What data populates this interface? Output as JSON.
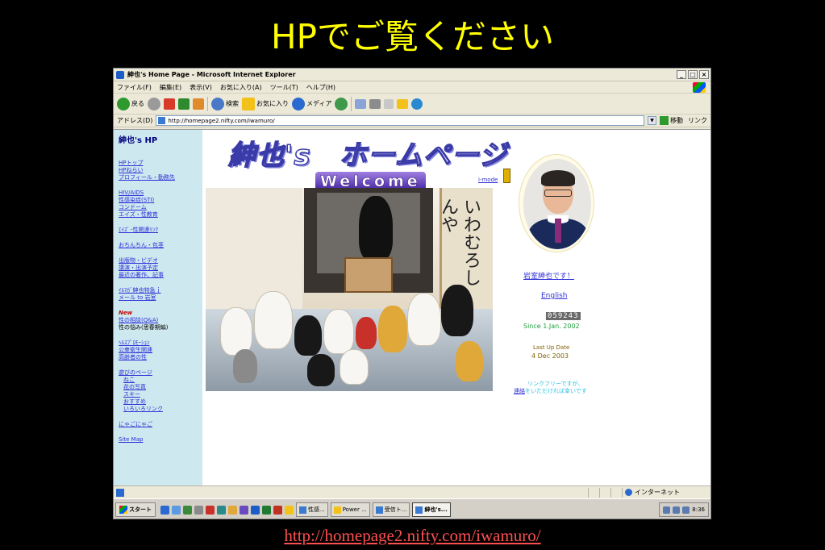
{
  "slide": {
    "title": "HPでご覧ください",
    "url": "http://homepage2.nifty.com/iwamuro/"
  },
  "window": {
    "title": "紳也's Home Page - Microsoft Internet Explorer",
    "controls": [
      "_",
      "□",
      "×"
    ]
  },
  "menu": [
    "ファイル(F)",
    "編集(E)",
    "表示(V)",
    "お気に入り(A)",
    "ツール(T)",
    "ヘルプ(H)"
  ],
  "toolbar": {
    "back": "戻る",
    "search": "検索",
    "favorites": "お気に入り",
    "media": "メディア"
  },
  "address": {
    "label": "アドレス(D)",
    "value": "http://homepage2.nifty.com/iwamuro/",
    "go": "移動",
    "links": "リンク"
  },
  "sidebar": {
    "title": "紳也's HP",
    "group1": [
      "HPトップ",
      "HPねらい",
      "プロフィール・勤務先"
    ],
    "group2": [
      "HIV/AIDS",
      "性感染症(STI)",
      "コンドーム",
      "エイズ・性教育"
    ],
    "group3": [
      "ｴｲｽﾞ･性関連ﾘﾝｸ"
    ],
    "group4": [
      "おちんちん・包茎"
    ],
    "group5": [
      "出版物・ビデオ",
      "講演・出演予定",
      "最近の著作、記事"
    ],
    "group6": [
      "ｲﾙﾏｶﾞ紳也特急ｊ",
      "メール to 岩室"
    ],
    "new_label": "New",
    "group7_link": "性の相談(Q&A)",
    "group7_text": "性の悩み(思春期編)",
    "group8": [
      "ﾍﾙｽﾌﾟﾛﾓｰｼｮﾝ",
      "公衆衛生関連",
      "高齢者の性"
    ],
    "group9": [
      "遊びのページ"
    ],
    "group9_sub": [
      "ねこ",
      "花の写真",
      "スキー",
      "おすすめ",
      "いろいろリンク"
    ],
    "group10": [
      "にゃごにゃご"
    ],
    "group11": [
      "Site Map"
    ]
  },
  "page": {
    "site_title": "紳也's　ホームページ",
    "welcome": "Welcome",
    "imode": "i-mode",
    "scroll_text": "いわむろしんや",
    "intro_link": "岩室紳也です！",
    "english_link": "English",
    "counter": "059243",
    "since": "Since 1.Jan. 2002",
    "update_label": "Last Up Date",
    "update_date": "4 Dec 2003",
    "linkfree": "リンクフリーですが、",
    "contact_link": "連絡",
    "contact_rest": "をいただければ幸いです"
  },
  "status": {
    "zone": "インターネット"
  },
  "taskbar": {
    "start": "スタート",
    "tasks": [
      "性感...",
      "Power ...",
      "受信ト...",
      "紳也's..."
    ],
    "clock": "8:36"
  },
  "colors": {
    "slide_title": "#ffff00",
    "slide_url": "#ff5050",
    "sidebar_bg": "#cde8ee",
    "link": "#3030d8"
  }
}
